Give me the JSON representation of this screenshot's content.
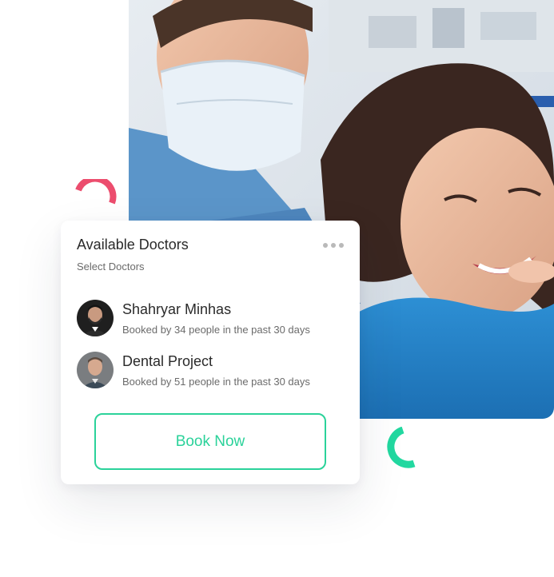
{
  "card": {
    "title": "Available Doctors",
    "subtitle": "Select Doctors",
    "more_icon": "more-horizontal-icon"
  },
  "doctors": [
    {
      "name": "Shahryar Minhas",
      "meta": "Booked by 34 people in the past 30 days"
    },
    {
      "name": "Dental Project",
      "meta": "Booked by 51 people in the past 30 days"
    }
  ],
  "book_button": {
    "label": "Book Now"
  },
  "colors": {
    "accent": "#2bd29a",
    "decor_pink": "#ec4d6e",
    "decor_green": "#22d8a0",
    "text_primary": "#2a2a2a",
    "text_secondary": "#6b6b6b"
  }
}
